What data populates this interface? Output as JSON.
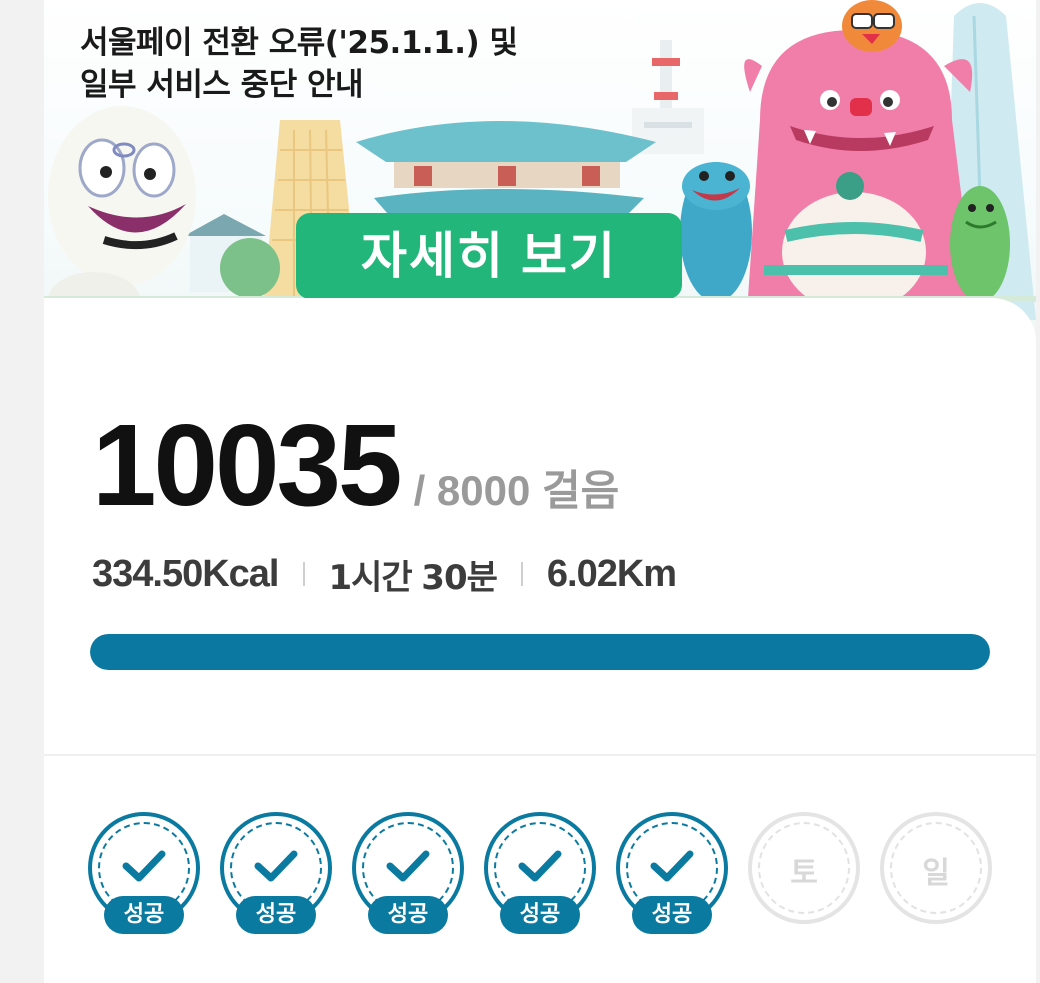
{
  "banner": {
    "title_line1": "서울페이 전환 오류('25.1.1.) 및",
    "title_line2": "일부 서비스 중단 안내",
    "detail_button": "자세히 보기",
    "colors": {
      "button": "#22b67a",
      "palace_roof": "#5fb8c4",
      "monster": "#f07ea8"
    }
  },
  "steps": {
    "count": "10035",
    "goal_text": "/ 8000",
    "unit": "걸음",
    "progress_fraction": 1.0
  },
  "stats": {
    "calories": "334.50Kcal",
    "duration_hours": "1시간",
    "duration_minutes": "30분",
    "distance": "6.02Km"
  },
  "week": {
    "success_label": "성공",
    "days": [
      {
        "status": "done"
      },
      {
        "status": "done"
      },
      {
        "status": "done"
      },
      {
        "status": "done"
      },
      {
        "status": "done"
      },
      {
        "status": "pending",
        "label": "토"
      },
      {
        "status": "pending",
        "label": "일"
      }
    ]
  },
  "colors": {
    "accent": "#0a78a0",
    "text_primary": "#111111",
    "text_muted": "#9a9a9a"
  }
}
